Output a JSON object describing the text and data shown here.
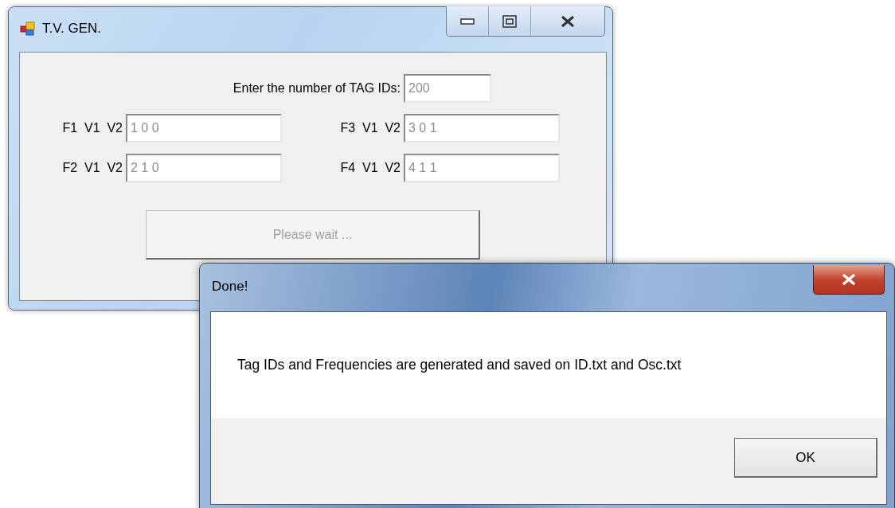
{
  "main_window": {
    "title": "T.V. GEN.",
    "tag_count": {
      "label": "Enter the number of TAG IDs:",
      "value": "200",
      "disabled": true
    },
    "pairs": [
      {
        "label": "F1  V1  V2",
        "value": "1 0 0",
        "disabled": true
      },
      {
        "label": "F3  V1  V2",
        "value": "3 0 1",
        "disabled": true
      },
      {
        "label": "F2  V1  V2",
        "value": "2 1 0",
        "disabled": true
      },
      {
        "label": "F4  V1  V2",
        "value": "4 1 1",
        "disabled": true
      }
    ],
    "button": {
      "label": "Please wait ...",
      "disabled": true
    }
  },
  "dialog": {
    "title": "Done!",
    "message": "Tag IDs and Frequencies are generated and saved on ID.txt and Osc.txt",
    "buttons": [
      {
        "label": "OK"
      }
    ]
  }
}
